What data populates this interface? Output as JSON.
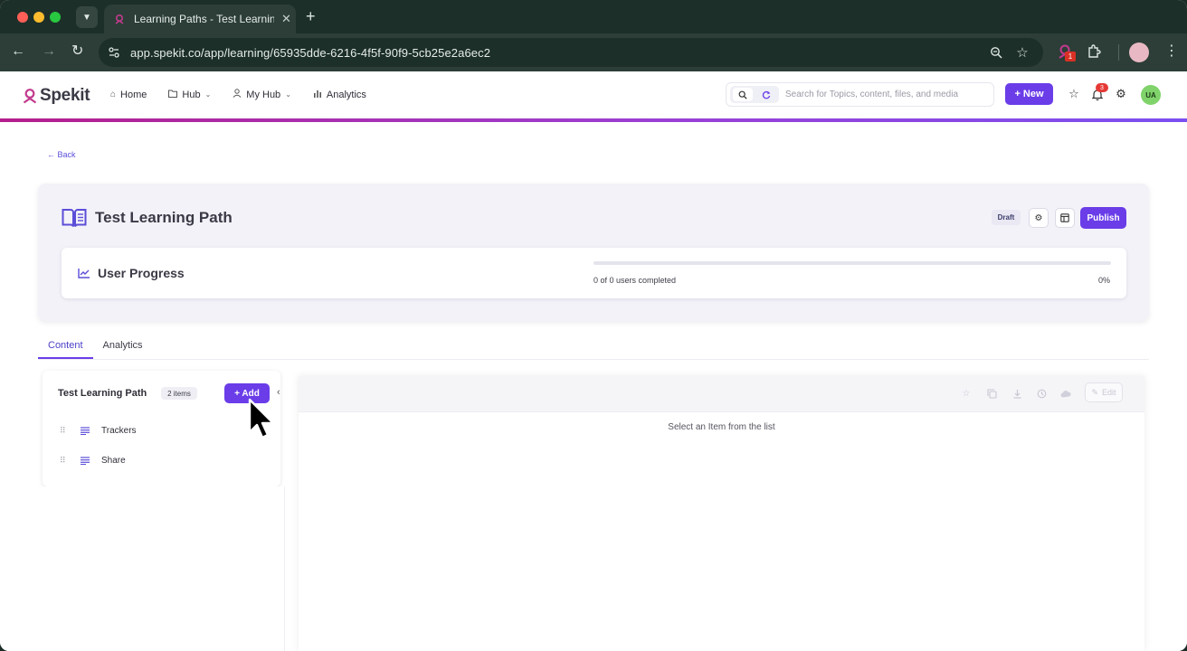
{
  "browser": {
    "tab_title": "Learning Paths - Test Learning",
    "tab_close": "✕",
    "new_tab": "+",
    "url": "app.spekit.co/app/learning/65935dde-6216-4f5f-90f9-5cb25e2a6ec2",
    "extension_badge": "1"
  },
  "header": {
    "logo_text": "Spekit",
    "nav": [
      {
        "label": "Home",
        "icon": "home-icon"
      },
      {
        "label": "Hub",
        "icon": "folder-icon",
        "dropdown": true
      },
      {
        "label": "My Hub",
        "icon": "user-icon",
        "dropdown": true
      },
      {
        "label": "Analytics",
        "icon": "bar-chart-icon"
      }
    ],
    "search_placeholder": "Search for Topics, content, files, and media",
    "new_button": "+ New",
    "notification_count": "3",
    "avatar_initials": "UA",
    "accent_color": "#6a3de8"
  },
  "page": {
    "back_label": "← Back",
    "title": "Test Learning Path",
    "status_badge": "Draft",
    "publish_button": "Publish",
    "progress": {
      "title": "User Progress",
      "completed_text": "0 of 0 users completed",
      "percent_label": "0%",
      "fraction": 0
    },
    "tabs": [
      {
        "label": "Content",
        "active": true
      },
      {
        "label": "Analytics",
        "active": false
      }
    ],
    "list": {
      "name": "Test Learning Path",
      "count_badge": "2 items",
      "add_button": "+ Add",
      "items": [
        {
          "label": "Trackers"
        },
        {
          "label": "Share"
        }
      ]
    },
    "detail": {
      "edit_button": "Edit",
      "empty_message": "Select an Item from the list"
    }
  }
}
